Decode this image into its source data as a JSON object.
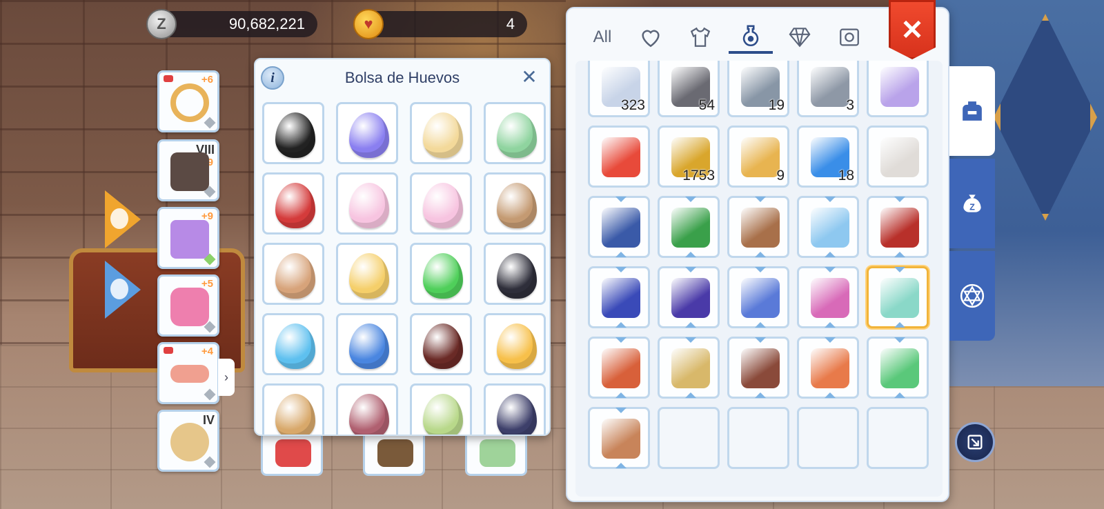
{
  "currency": {
    "zeny_icon": "Z",
    "zeny_amount": "90,682,221",
    "egg_coin_amount": "4"
  },
  "equipment": [
    {
      "name": "ring",
      "level": "+6",
      "color": "#e8b35a"
    },
    {
      "name": "armor",
      "level": "+9",
      "tier": "VIII",
      "color": "#5b4a44"
    },
    {
      "name": "garment",
      "level": "+9",
      "color": "#b78ae6"
    },
    {
      "name": "shoes",
      "level": "+5",
      "color": "#ee7fae"
    },
    {
      "name": "belt",
      "level": "+4",
      "color": "#f0a090"
    },
    {
      "name": "moon-accessory",
      "tier": "IV",
      "color": "#e6c68a"
    }
  ],
  "egg_panel": {
    "title": "Bolsa de Huevos",
    "info_label": "i",
    "close_label": "✕",
    "eggs": [
      {
        "icon": "poring-black-egg",
        "color": "#222222"
      },
      {
        "icon": "angel-wing-egg",
        "color": "#8a7ff0"
      },
      {
        "icon": "gold-crown-egg",
        "color": "#f3d99a"
      },
      {
        "icon": "green-spotted-egg",
        "color": "#8fd49f"
      },
      {
        "icon": "helmet-egg",
        "color": "#d43b3b"
      },
      {
        "icon": "pink-bunny-egg",
        "color": "#f7c4e0"
      },
      {
        "icon": "pink-flower-egg",
        "color": "#f7c4e0"
      },
      {
        "icon": "brown-feather-egg",
        "color": "#c49a72"
      },
      {
        "icon": "spiked-egg",
        "color": "#d7a37a"
      },
      {
        "icon": "yellow-egg",
        "color": "#f5cf6a"
      },
      {
        "icon": "leaf-green-egg",
        "color": "#4fcf5a"
      },
      {
        "icon": "black-cat-egg",
        "color": "#2e2e3a"
      },
      {
        "icon": "blue-drop-egg",
        "color": "#5ec0ef"
      },
      {
        "icon": "blue-swirl-egg",
        "color": "#4a86e0"
      },
      {
        "icon": "dragon-eye-egg",
        "color": "#6a2a26"
      },
      {
        "icon": "fire-antler-egg",
        "color": "#f7c04a"
      },
      {
        "icon": "flower-crown-egg",
        "color": "#d8a86a"
      },
      {
        "icon": "purple-egg",
        "color": "#b06070"
      },
      {
        "icon": "striped-green-egg",
        "color": "#b8d88a"
      },
      {
        "icon": "dark-striped-egg",
        "color": "#3d3f6a"
      }
    ]
  },
  "peek_row": [
    {
      "icon": "red-tool-icon",
      "color": "#e04a4a"
    },
    {
      "icon": "cannon-icon",
      "color": "#7a5a3a"
    },
    {
      "icon": "fairy-icon",
      "color": "#9fd39a"
    }
  ],
  "inventory": {
    "tabs": [
      {
        "name": "tab-all",
        "label": "All"
      },
      {
        "name": "tab-favorites",
        "icon": "heart-icon"
      },
      {
        "name": "tab-equipment",
        "icon": "shirt-icon"
      },
      {
        "name": "tab-consumables",
        "icon": "potion-icon"
      },
      {
        "name": "tab-gems",
        "icon": "diamond-icon"
      },
      {
        "name": "tab-cards",
        "icon": "card-icon"
      }
    ],
    "close_label": "✕",
    "items": [
      {
        "icon": "crystal-ore-icon",
        "qty": "323",
        "color": "#c8d4e8"
      },
      {
        "icon": "dark-stone-icon",
        "qty": "54",
        "color": "#6a6a72"
      },
      {
        "icon": "gray-rock-icon",
        "qty": "19",
        "color": "#8896a6"
      },
      {
        "icon": "pebble-icon",
        "qty": "3",
        "color": "#8e98a6"
      },
      {
        "icon": "purple-ring-icon",
        "qty": "",
        "color": "#b9a3ea"
      },
      {
        "icon": "red-crystal-icon",
        "qty": "",
        "color": "#e84a3a"
      },
      {
        "icon": "holy-book-icon",
        "qty": "1753",
        "color": "#d9a62c"
      },
      {
        "icon": "ticket-icon",
        "qty": "9",
        "color": "#e8b450"
      },
      {
        "icon": "blue-gem-icon",
        "qty": "18",
        "color": "#3a8ee8"
      },
      {
        "icon": "angel-statue-icon",
        "qty": "",
        "color": "#e0dcd8"
      },
      {
        "icon": "blue-book-icon",
        "qty": "",
        "color": "#3a5aa8",
        "frame": true
      },
      {
        "icon": "green-book-icon",
        "qty": "",
        "color": "#3aa04a",
        "frame": true
      },
      {
        "icon": "gift-sack-icon",
        "qty": "",
        "color": "#a8704a",
        "frame": true
      },
      {
        "icon": "crystal-box-icon",
        "qty": "",
        "color": "#8ec8f0",
        "frame": true
      },
      {
        "icon": "red-tome-icon",
        "qty": "",
        "color": "#b8302a",
        "frame": true
      },
      {
        "icon": "blue-case-icon",
        "qty": "",
        "color": "#3a4ab8",
        "frame": true
      },
      {
        "icon": "magic-drum-icon",
        "qty": "",
        "color": "#4a3aa8",
        "frame": true
      },
      {
        "icon": "blueprint-icon",
        "qty": "",
        "color": "#5a7ad8",
        "frame": true
      },
      {
        "icon": "costume-box-icon",
        "qty": "",
        "color": "#d86ab8",
        "frame": true
      },
      {
        "icon": "egg-box-icon",
        "qty": "",
        "color": "#8ad8c8",
        "frame": true,
        "selected": true
      },
      {
        "icon": "orange-book-icon",
        "qty": "",
        "color": "#d8603a",
        "frame": true
      },
      {
        "icon": "golden-tower-icon",
        "qty": "",
        "color": "#d8b86a",
        "frame": true
      },
      {
        "icon": "leather-book-icon",
        "qty": "",
        "color": "#8a4a3a",
        "frame": true
      },
      {
        "icon": "coin-pouch-icon",
        "qty": "",
        "color": "#e87a4a",
        "frame": true
      },
      {
        "icon": "mystery-box-icon",
        "qty": "",
        "color": "#5ac87a",
        "frame": true
      },
      {
        "icon": "backpack-icon",
        "qty": "",
        "color": "#c8845a",
        "frame": true
      },
      {
        "icon": "",
        "qty": "",
        "color": ""
      },
      {
        "icon": "",
        "qty": "",
        "color": ""
      },
      {
        "icon": "",
        "qty": "",
        "color": ""
      },
      {
        "icon": "",
        "qty": "",
        "color": ""
      }
    ]
  },
  "side_tabs": [
    {
      "name": "backpack-icon"
    },
    {
      "name": "zeny-bag-icon"
    },
    {
      "name": "hexagram-icon"
    }
  ]
}
